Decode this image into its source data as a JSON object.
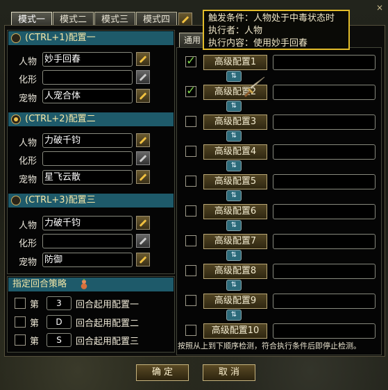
{
  "tabs": [
    "模式一",
    "模式二",
    "模式三",
    "模式四"
  ],
  "configs": [
    {
      "title": "(CTRL+1)配置一",
      "radio_on": false,
      "rows": [
        {
          "label": "人物",
          "value": "妙手回春"
        },
        {
          "label": "化形",
          "value": ""
        },
        {
          "label": "宠物",
          "value": "人宠合体"
        }
      ]
    },
    {
      "title": "(CTRL+2)配置二",
      "radio_on": true,
      "rows": [
        {
          "label": "人物",
          "value": "力破千钧"
        },
        {
          "label": "化形",
          "value": ""
        },
        {
          "label": "宠物",
          "value": "星飞云散"
        }
      ]
    },
    {
      "title": "(CTRL+3)配置三",
      "radio_on": false,
      "rows": [
        {
          "label": "人物",
          "value": "力破千钧"
        },
        {
          "label": "化形",
          "value": ""
        },
        {
          "label": "宠物",
          "value": "防御"
        }
      ]
    }
  ],
  "strategy": {
    "title": "指定回合策略",
    "rows": [
      {
        "prefix": "第",
        "value": "3",
        "suffix": "回合起用配置一"
      },
      {
        "prefix": "第",
        "value": "D",
        "suffix": "回合起用配置二"
      },
      {
        "prefix": "第",
        "value": "S",
        "suffix": "回合起用配置三"
      }
    ]
  },
  "right_tab_left": "通用",
  "advanced": [
    {
      "label": "高级配置1",
      "checked": true
    },
    {
      "label": "高级配置2",
      "checked": true
    },
    {
      "label": "高级配置3",
      "checked": false
    },
    {
      "label": "高级配置4",
      "checked": false
    },
    {
      "label": "高级配置5",
      "checked": false
    },
    {
      "label": "高级配置6",
      "checked": false
    },
    {
      "label": "高级配置7",
      "checked": false
    },
    {
      "label": "高级配置8",
      "checked": false
    },
    {
      "label": "高级配置9",
      "checked": false
    },
    {
      "label": "高级配置10",
      "checked": false
    }
  ],
  "swap_glyph": "⇅",
  "footnote": "按照从上到下顺序检测，符合执行条件后即停止检测。",
  "tooltip": {
    "line1": "触发条件：人物处于中毒状态时",
    "line2": "执行者：人物",
    "line3": "执行内容：使用妙手回春"
  },
  "buttons": {
    "ok": "确 定",
    "cancel": "取 消"
  },
  "close_glyph": "×"
}
